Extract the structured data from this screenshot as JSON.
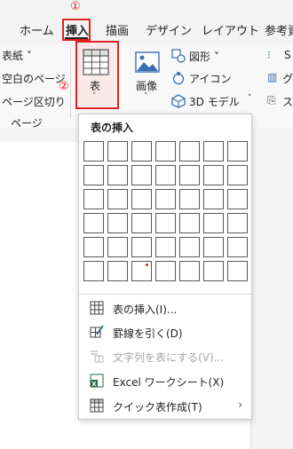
{
  "tabs": {
    "home": "ホーム",
    "insert": "挿入",
    "draw": "描画",
    "design": "デザイン",
    "layout": "レイアウト",
    "refs": "参考資"
  },
  "callouts": {
    "one": "①",
    "two": "②"
  },
  "ribbon": {
    "cover_page": "表紙",
    "blank_page": "空白のページ",
    "page_break": "ページ区切り",
    "page_group": "ページ",
    "table_label": "表",
    "image_label": "画像",
    "shapes_label": "図形",
    "icons_label": "アイコン",
    "model3d_label": "3D モデル",
    "right_s": "S",
    "right_g": "グ",
    "right_s2": "ス"
  },
  "panel": {
    "title": "表の挿入",
    "grid": {
      "columns": 7,
      "rows": 6
    },
    "items": [
      {
        "label": "表の挿入(I)...",
        "disabled": false,
        "icon": "table-insert-icon"
      },
      {
        "label": "罫線を引く(D)",
        "disabled": false,
        "icon": "draw-table-icon"
      },
      {
        "label": "文字列を表にする(V)...",
        "disabled": true,
        "icon": "convert-text-icon"
      },
      {
        "label": "Excel ワークシート(X)",
        "disabled": false,
        "icon": "excel-icon"
      },
      {
        "label": "クイック表作成(T)",
        "disabled": false,
        "icon": "quick-tables-icon",
        "submenu": true
      }
    ]
  },
  "colors": {
    "accent_red": "#e0201f",
    "excel_green": "#1d6f42",
    "panel_bg": "#ffffff"
  }
}
